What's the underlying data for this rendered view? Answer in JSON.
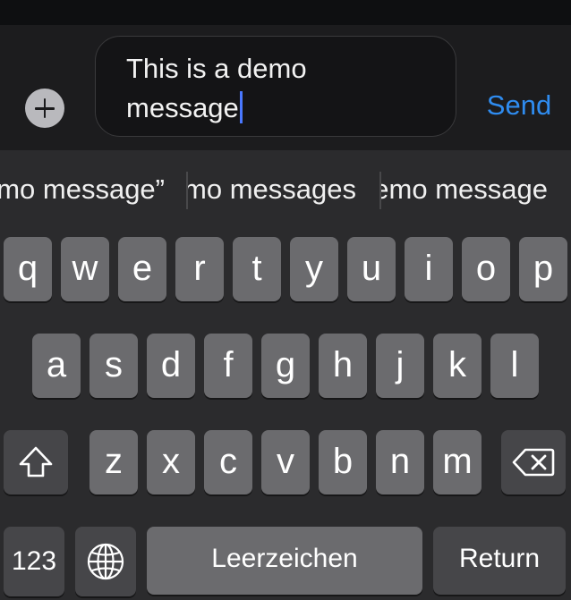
{
  "composer": {
    "text": "This is a demo\nmessage",
    "send_label": "Send",
    "add_icon": "plus-circle-icon"
  },
  "suggestions": [
    "“demo message”",
    "demo messages",
    "demo message"
  ],
  "keyboard": {
    "row1": [
      "q",
      "w",
      "e",
      "r",
      "t",
      "y",
      "u",
      "i",
      "o",
      "p"
    ],
    "row2": [
      "a",
      "s",
      "d",
      "f",
      "g",
      "h",
      "j",
      "k",
      "l"
    ],
    "row3": [
      "z",
      "x",
      "c",
      "v",
      "b",
      "n",
      "m"
    ],
    "shift_icon": "shift-icon",
    "backspace_icon": "backspace-icon",
    "numbers_label": "123",
    "globe_icon": "globe-icon",
    "space_label": "Leerzeichen",
    "return_label": "Return"
  },
  "colors": {
    "accent": "#2f8cf0",
    "caret": "#4a78ff",
    "key": "#6b6b6e",
    "key_dark": "#464649",
    "keyboard_bg": "#2b2b2d"
  }
}
